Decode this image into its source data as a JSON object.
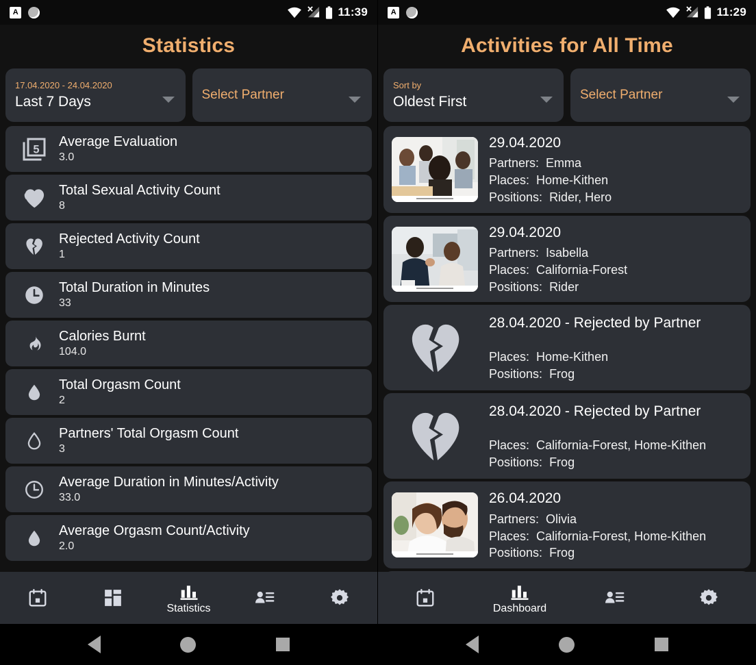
{
  "accent_color": "#f0ae6e",
  "card_color": "#2d3036",
  "screens": [
    {
      "id": "statistics",
      "statusbar": {
        "icons": [
          "a-badge-icon",
          "circle-icon",
          "wifi-icon",
          "cellular-off-icon",
          "battery-icon"
        ],
        "a_badge": "A",
        "time": "11:39"
      },
      "title": "Statistics",
      "filters": [
        {
          "label": "17.04.2020 - 24.04.2020",
          "value": "Last 7 Days",
          "is_placeholder": false
        },
        {
          "label": "",
          "value": "Select Partner",
          "is_placeholder": true
        }
      ],
      "stats": [
        {
          "icon": "filter-5-icon",
          "name": "Average Evaluation",
          "value": "3.0"
        },
        {
          "icon": "heart-filled-icon",
          "name": "Total Sexual Activity Count",
          "value": "8"
        },
        {
          "icon": "heart-broken-icon",
          "name": "Rejected Activity Count",
          "value": "1"
        },
        {
          "icon": "clock-filled-icon",
          "name": "Total Duration in Minutes",
          "value": "33"
        },
        {
          "icon": "flame-icon",
          "name": "Calories Burnt",
          "value": "104.0"
        },
        {
          "icon": "droplet-filled-icon",
          "name": "Total Orgasm Count",
          "value": "2"
        },
        {
          "icon": "droplet-outline-icon",
          "name": "Partners' Total Orgasm Count",
          "value": "3"
        },
        {
          "icon": "clock-outline-icon",
          "name": "Average Duration in Minutes/Activity",
          "value": "33.0"
        },
        {
          "icon": "droplet-filled-icon",
          "name": "Average Orgasm Count/Activity",
          "value": "2.0"
        }
      ],
      "nav": [
        {
          "icon": "calendar-icon",
          "label": ""
        },
        {
          "icon": "dashboard-grid-icon",
          "label": ""
        },
        {
          "icon": "bar-chart-icon",
          "label": "Statistics"
        },
        {
          "icon": "contacts-icon",
          "label": ""
        },
        {
          "icon": "gear-icon",
          "label": ""
        }
      ]
    },
    {
      "id": "activities",
      "statusbar": {
        "icons": [
          "a-badge-icon",
          "circle-icon",
          "wifi-icon",
          "cellular-off-icon",
          "battery-icon"
        ],
        "a_badge": "A",
        "time": "11:29"
      },
      "title": "Activities for All Time",
      "filters": [
        {
          "label": "Sort by",
          "value": "Oldest First",
          "is_placeholder": false
        },
        {
          "label": "",
          "value": "Select Partner",
          "is_placeholder": true
        }
      ],
      "activities": [
        {
          "thumb": "photo-group-meeting",
          "date": "29.04.2020",
          "rejected": false,
          "lines": [
            {
              "label": "Partners:",
              "value": "Emma"
            },
            {
              "label": "Places:",
              "value": "Home-Kithen"
            },
            {
              "label": "Positions:",
              "value": "Rider, Hero"
            }
          ]
        },
        {
          "thumb": "photo-two-women-desk",
          "date": "29.04.2020",
          "rejected": false,
          "lines": [
            {
              "label": "Partners:",
              "value": "Isabella"
            },
            {
              "label": "Places:",
              "value": "California-Forest"
            },
            {
              "label": "Positions:",
              "value": "Rider"
            }
          ]
        },
        {
          "thumb": "heart-broken-icon",
          "date": "28.04.2020 - Rejected by Partner",
          "rejected": true,
          "lines": [
            {
              "label": "Places:",
              "value": "Home-Kithen"
            },
            {
              "label": "Positions:",
              "value": "Frog"
            }
          ]
        },
        {
          "thumb": "heart-broken-icon",
          "date": "28.04.2020 - Rejected by Partner",
          "rejected": true,
          "lines": [
            {
              "label": "Places:",
              "value": "California-Forest, Home-Kithen"
            },
            {
              "label": "Positions:",
              "value": "Frog"
            }
          ]
        },
        {
          "thumb": "photo-couple-smiling",
          "date": "26.04.2020",
          "rejected": false,
          "lines": [
            {
              "label": "Partners:",
              "value": "Olivia"
            },
            {
              "label": "Places:",
              "value": "California-Forest, Home-Kithen"
            },
            {
              "label": "Positions:",
              "value": "Frog"
            }
          ]
        }
      ],
      "nav": [
        {
          "icon": "calendar-icon",
          "label": ""
        },
        {
          "icon": "bar-chart-icon",
          "label": "Dashboard"
        },
        {
          "icon": "contacts-icon",
          "label": ""
        },
        {
          "icon": "gear-icon",
          "label": ""
        }
      ]
    }
  ],
  "sysnav": {
    "back": "back-icon",
    "home": "home-icon",
    "recent": "recents-icon"
  }
}
